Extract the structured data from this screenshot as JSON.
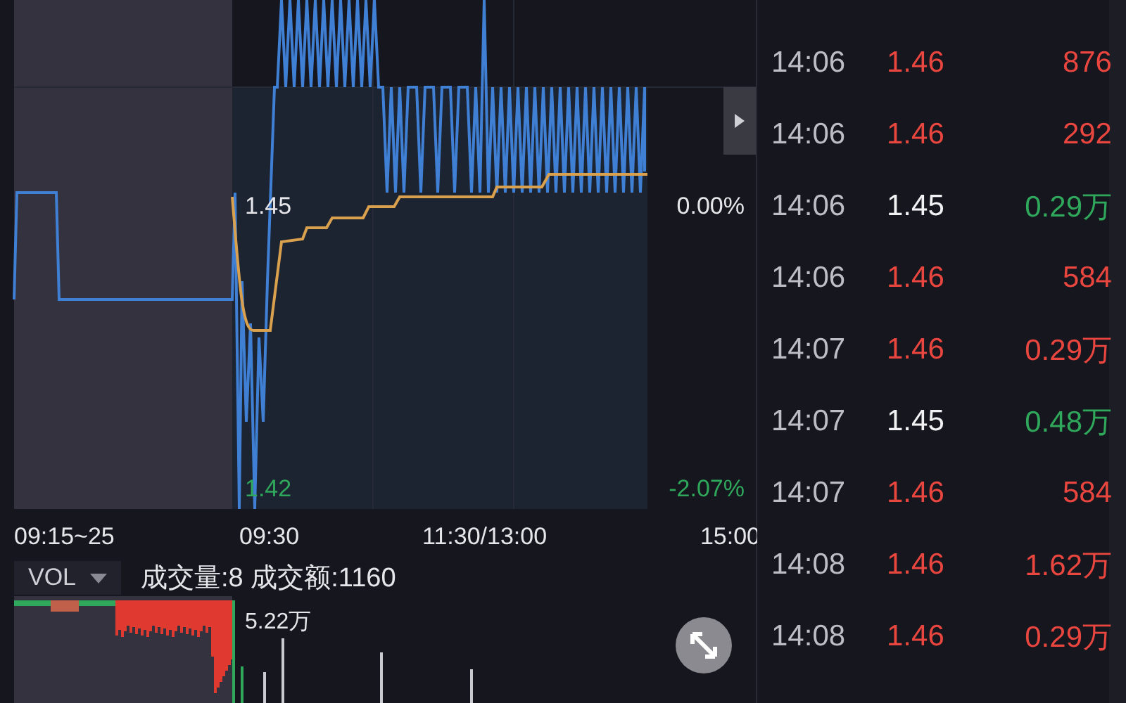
{
  "chart": {
    "scale_top": [
      {
        "text": "1.45",
        "kind": "flat"
      },
      {
        "text": "0.00%",
        "kind": "flat"
      }
    ],
    "scale_bottom": [
      {
        "text": "1.42",
        "kind": "down"
      },
      {
        "text": "-2.07%",
        "kind": "down"
      }
    ],
    "time_axis": [
      "09:15~25",
      "09:30",
      "11:30/13:00",
      "15:00"
    ]
  },
  "indicator": {
    "selector": "VOL",
    "volume_text": "成交量:8 成交额:1160",
    "max_label": "5.22万"
  },
  "trades": [
    {
      "time": "14:06",
      "price": "1.46",
      "volume": "876",
      "kind": "buy"
    },
    {
      "time": "14:06",
      "price": "1.46",
      "volume": "292",
      "kind": "buy"
    },
    {
      "time": "14:06",
      "price": "1.45",
      "volume": "0.29万",
      "kind": "sell"
    },
    {
      "time": "14:06",
      "price": "1.46",
      "volume": "584",
      "kind": "buy"
    },
    {
      "time": "14:07",
      "price": "1.46",
      "volume": "0.29万",
      "kind": "buy"
    },
    {
      "time": "14:07",
      "price": "1.45",
      "volume": "0.48万",
      "kind": "sell"
    },
    {
      "time": "14:07",
      "price": "1.46",
      "volume": "584",
      "kind": "buy"
    },
    {
      "time": "14:08",
      "price": "1.46",
      "volume": "1.62万",
      "kind": "buy"
    },
    {
      "time": "14:08",
      "price": "1.46",
      "volume": "0.29万",
      "kind": "buy"
    }
  ]
}
